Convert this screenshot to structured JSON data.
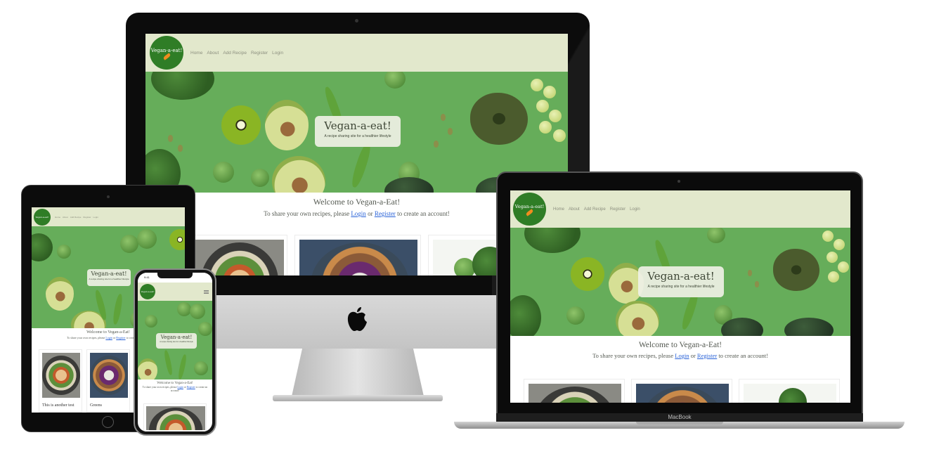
{
  "site": {
    "logo_text": "Vegan-a-eat!",
    "nav": [
      "Home",
      "About",
      "Add Recipe",
      "Register",
      "Login"
    ],
    "hero_title": "Vegan-a-eat!",
    "hero_subtitle": "A recipe sharing site for a healthier lifestyle",
    "welcome_title": "Welcome to Vegan-a-Eat!",
    "welcome_prefix": "To share your own recipes, please",
    "login_link": "Login",
    "or_word": "or",
    "register_link": "Register",
    "welcome_suffix": "to create an account!"
  },
  "tablet_cards": {
    "card1_title": "This is another test",
    "card2_title": "Greens"
  },
  "laptop": {
    "brand": "MacBook"
  },
  "phone": {
    "time": "9:41"
  },
  "colors": {
    "nav_bg": "#e2e8cc",
    "logo_green": "#2f7d26",
    "hero_green": "#66ad5a",
    "link_blue": "#2a63d8"
  },
  "icons": {
    "apple": "apple-logo-icon",
    "hamburger": "hamburger-menu-icon"
  }
}
